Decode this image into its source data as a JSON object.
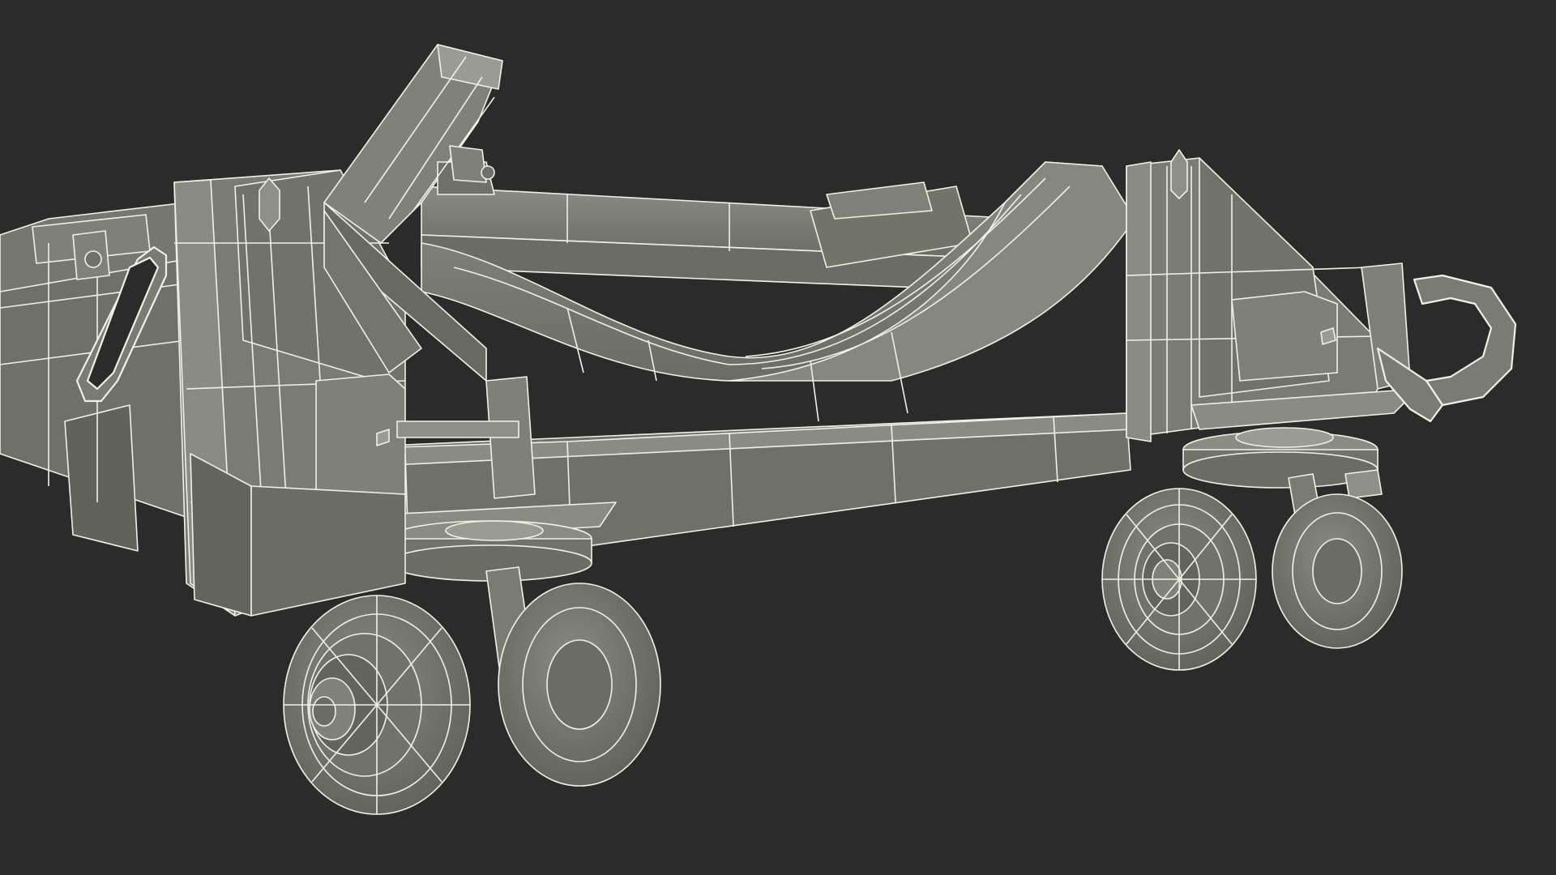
{
  "scene": {
    "background": "#2b2b2b",
    "mesh_fill": "#767870",
    "mesh_fill_light": "#8a8c83",
    "mesh_fill_dark": "#5c5e57",
    "wire_color": "#f2f0e6",
    "subject": "wheeled-cradle-dolly-wireframe"
  }
}
